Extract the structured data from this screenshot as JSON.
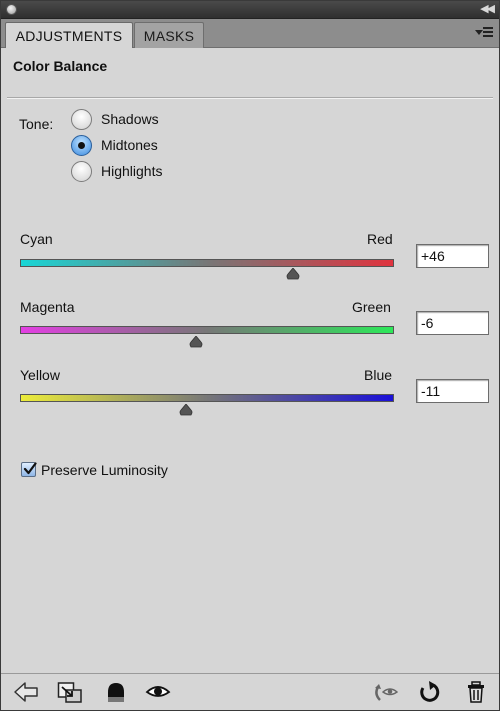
{
  "tabs": [
    {
      "label": "ADJUSTMENTS",
      "active": true
    },
    {
      "label": "MASKS",
      "active": false
    }
  ],
  "panel": {
    "title": "Color Balance"
  },
  "tone": {
    "label": "Tone:",
    "options": [
      {
        "label": "Shadows",
        "selected": false
      },
      {
        "label": "Midtones",
        "selected": true
      },
      {
        "label": "Highlights",
        "selected": false
      }
    ]
  },
  "sliders": [
    {
      "left_label": "Cyan",
      "right_label": "Red",
      "value": "+46",
      "numeric": 46,
      "min": -100,
      "max": 100,
      "colors": [
        "#19d6d6",
        "#e0343f"
      ]
    },
    {
      "left_label": "Magenta",
      "right_label": "Green",
      "value": "-6",
      "numeric": -6,
      "min": -100,
      "max": 100,
      "colors": [
        "#e33fe3",
        "#2de85a"
      ]
    },
    {
      "left_label": "Yellow",
      "right_label": "Blue",
      "value": "-11",
      "numeric": -11,
      "min": -100,
      "max": 100,
      "colors": [
        "#ecec3a",
        "#1a10d8"
      ]
    }
  ],
  "preserve_luminosity": {
    "label": "Preserve Luminosity",
    "checked": true
  },
  "toolbar": {
    "icons": [
      "back-arrow-icon",
      "clip-to-layer-icon",
      "layer-visibility-mask-icon",
      "eye-icon",
      "view-previous-icon",
      "reset-icon",
      "trash-icon"
    ]
  }
}
